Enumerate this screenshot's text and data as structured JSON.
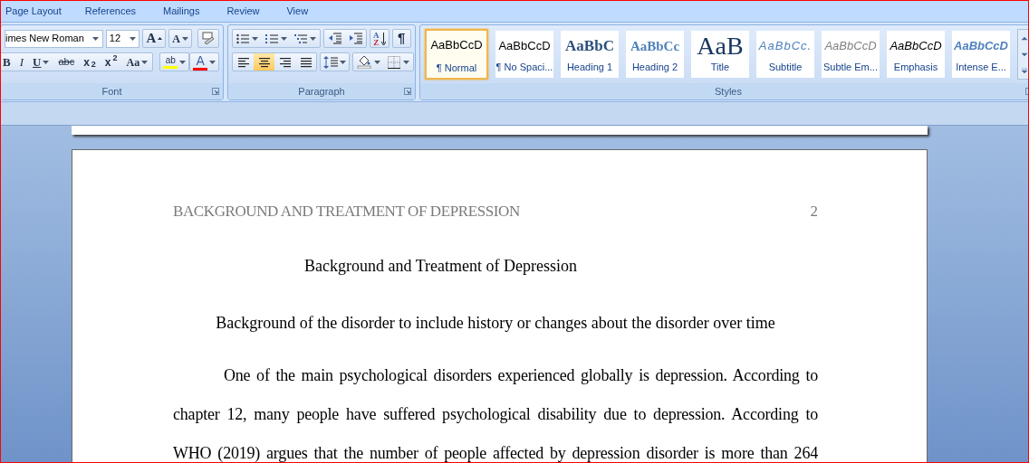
{
  "menu_tabs": [
    {
      "label": "Page Layout",
      "selected": false
    },
    {
      "label": "References",
      "selected": false
    },
    {
      "label": "Mailings",
      "selected": false
    },
    {
      "label": "Review",
      "selected": false
    },
    {
      "label": "View",
      "selected": false
    }
  ],
  "font_group": {
    "title": "Font",
    "font_name": "imes New Roman",
    "font_size": "12",
    "grow_label": "A",
    "shrink_label": "A",
    "format_buttons": [
      {
        "kind": "bold",
        "label": "B"
      },
      {
        "kind": "italic",
        "label": "I"
      },
      {
        "kind": "underline",
        "label": "U"
      },
      {
        "kind": "strike",
        "label": "abc"
      },
      {
        "kind": "sub",
        "label": "x$_{2}$"
      },
      {
        "kind": "sup",
        "label": "x$^{2}$"
      },
      {
        "kind": "case",
        "label": "Aa"
      }
    ],
    "highlight": {
      "label": "ab",
      "color": "#ffff00"
    },
    "font_color": {
      "label": "A",
      "color": "#ff0000"
    }
  },
  "paragraph_group": {
    "title": "Paragraph",
    "sort_top": "A",
    "sort_bottom": "Z",
    "pilcrow": "¶",
    "alignments": [
      {
        "kind": "left",
        "selected": false
      },
      {
        "kind": "center",
        "selected": true
      },
      {
        "kind": "right",
        "selected": false
      },
      {
        "kind": "justify",
        "selected": false
      }
    ]
  },
  "styles_group": {
    "title": "Styles",
    "styles": [
      {
        "kind": "normal",
        "sample": "AaBbCcD",
        "label": "¶ Normal",
        "selected": true
      },
      {
        "kind": "normal",
        "sample": "AaBbCcD",
        "label": "¶ No Spaci...",
        "selected": false
      },
      {
        "kind": "heading1",
        "sample": "AaBbC",
        "label": "Heading 1",
        "selected": false
      },
      {
        "kind": "heading2",
        "sample": "AaBbCc",
        "label": "Heading 2",
        "selected": false
      },
      {
        "kind": "title",
        "sample": "AaB",
        "label": "Title",
        "selected": false
      },
      {
        "kind": "subtitle",
        "sample": "AaBbCc.",
        "label": "Subtitle",
        "selected": false
      },
      {
        "kind": "subtle",
        "sample": "AaBbCcD",
        "label": "Subtle Em...",
        "selected": false
      },
      {
        "kind": "emphasis",
        "sample": "AaBbCcD",
        "label": "Emphasis",
        "selected": false
      },
      {
        "kind": "intense",
        "sample": "AaBbCcD",
        "label": "Intense E...",
        "selected": false
      }
    ]
  },
  "document": {
    "header": "BACKGROUND AND TREATMENT OF DEPRESSION",
    "page_number": "2",
    "title": "Background and Treatment of Depression",
    "subheading": "Background of the disorder to include history or changes about the disorder over time",
    "paragraph": "One of the main psychological disorders experienced globally is depression. According to chapter 12, many people have suffered psychological disability due to depression. According to WHO (2019) argues that the number of people affected by depression disorder is more than 264"
  }
}
